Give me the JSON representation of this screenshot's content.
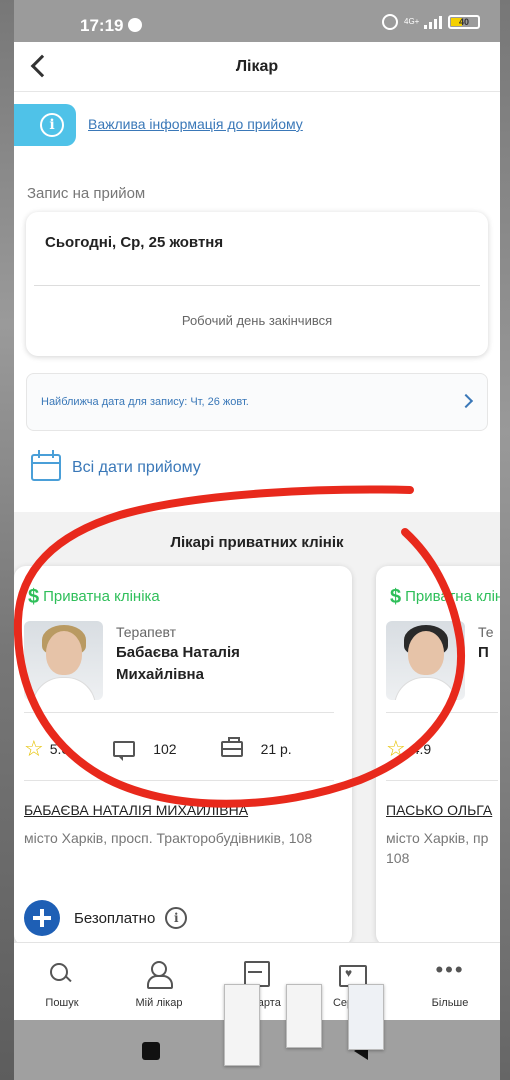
{
  "status_bar": {
    "time": "17:19",
    "network": "4G+",
    "battery": "40"
  },
  "header": {
    "title": "Лікар"
  },
  "info": {
    "link_text": "Важлива інформація до прийому"
  },
  "appointment": {
    "section_label": "Запис на прийом",
    "date": "Сьогодні, Ср, 25 жовтня",
    "status": "Робочий день закінчився",
    "nearest": "Найближча дата для запису: Чт, 26 жовт.",
    "all_dates": "Всі дати прийому"
  },
  "clinics": {
    "title": "Лікарі приватних клінік",
    "cards": [
      {
        "clinic_label": "Приватна клініка",
        "specialty": "Терапевт",
        "name": "Бабаєва Наталія Михайлівна",
        "rating": "5.0",
        "reviews": "102",
        "experience": "21 р.",
        "full_name_upper": "БАБАЄВА НАТАЛІЯ МИХАЙЛІВНА",
        "address": "місто Харків, просп. Тракторобудівників, 108",
        "price": "Безоплатно"
      },
      {
        "clinic_label": "Приватна клініка",
        "specialty": "Те",
        "name": "П",
        "rating": "4.9",
        "full_name_upper": "ПАСЬКО ОЛЬГА",
        "address": "місто Харків, пр 108"
      }
    ]
  },
  "bottom_nav": {
    "items": [
      {
        "label": "Пошук",
        "icon": "search-icon"
      },
      {
        "label": "Мій лікар",
        "icon": "doctor-icon"
      },
      {
        "label": "Медкарта",
        "icon": "medcard-icon"
      },
      {
        "label": "Сервіси",
        "icon": "services-icon"
      },
      {
        "label": "Більше",
        "icon": "more-icon"
      }
    ]
  },
  "colors": {
    "accent_blue": "#3a78b8",
    "clinic_green": "#2fbf5a",
    "annotation_red": "#e8291c",
    "info_button": "#4fc2e8"
  }
}
